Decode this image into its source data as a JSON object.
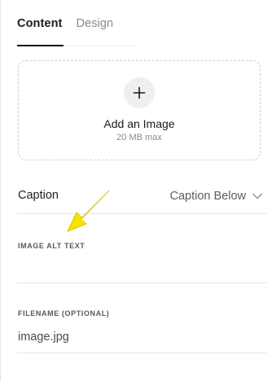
{
  "tabs": [
    {
      "label": "Content",
      "active": true
    },
    {
      "label": "Design",
      "active": false
    }
  ],
  "dropzone": {
    "icon": "plus-icon",
    "title": "Add an Image",
    "subtitle": "20 MB max"
  },
  "caption": {
    "label": "Caption",
    "value": "Caption Below",
    "icon": "chevron-down-icon"
  },
  "alt_text": {
    "label": "IMAGE ALT TEXT",
    "value": ""
  },
  "filename": {
    "label": "FILENAME (OPTIONAL)",
    "value": "image.jpg"
  },
  "annotation": {
    "icon": "arrow-pointer-icon",
    "color": "#f5e400"
  },
  "colors": {
    "text": "#1f1f1f",
    "muted": "#8a8a8a",
    "divider": "#e6e6e6",
    "dropzone_border": "#cfcfcf"
  }
}
